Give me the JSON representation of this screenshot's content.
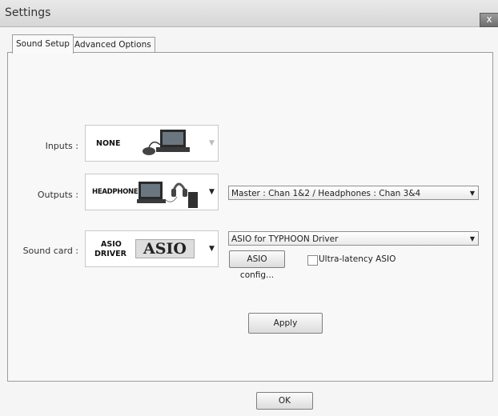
{
  "window": {
    "title": "Settings",
    "close_label": "x"
  },
  "tabs": [
    "Sound Setup",
    "Advanced Options"
  ],
  "inputs": {
    "label": "Inputs :",
    "device": "NONE",
    "arrow": "▼"
  },
  "outputs": {
    "label": "Outputs :",
    "device": "HEADPHONES",
    "arrow": "▼",
    "routing": "Master : Chan 1&2 / Headphones : Chan 3&4"
  },
  "soundcard": {
    "label": "Sound card :",
    "device_line1": "ASIO",
    "device_line2": "DRIVER",
    "logo": "ASIO",
    "arrow": "▼",
    "driver": "ASIO for TYPHOON Driver",
    "config_button": "ASIO config...",
    "ultra_label": "Ultra-latency ASIO",
    "ultra_checked": false
  },
  "buttons": {
    "apply": "Apply",
    "ok": "OK"
  }
}
